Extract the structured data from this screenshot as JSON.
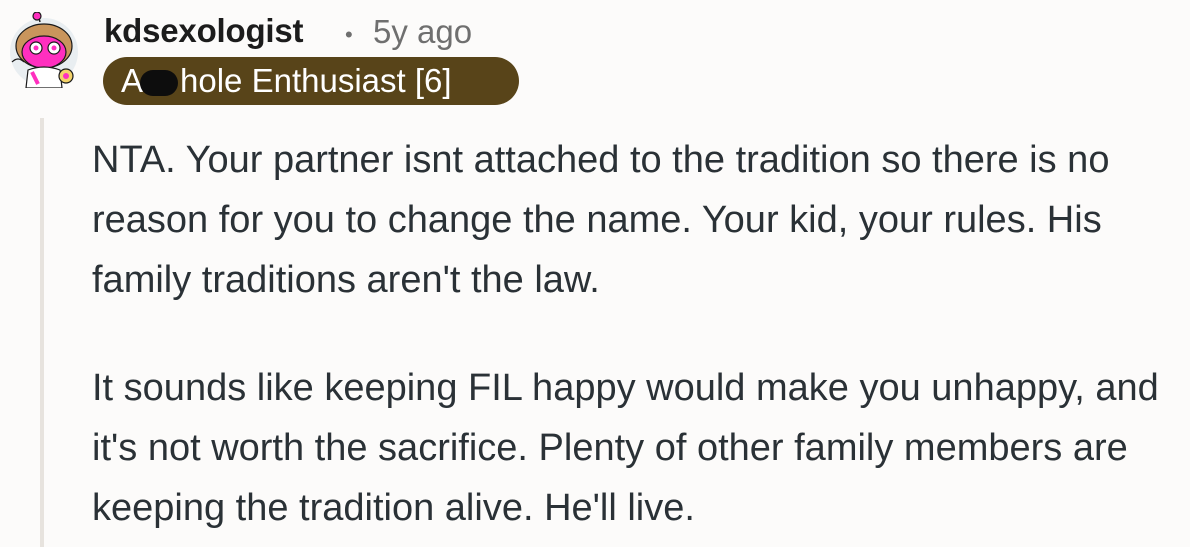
{
  "comment": {
    "author": "kdsexologist",
    "separator": "•",
    "timestamp": "5y ago",
    "flair": {
      "prefix": "A",
      "suffix": "hole Enthusiast [6]",
      "background_color": "#584419"
    },
    "avatar_icon": "snoo-avatar-icon",
    "paragraphs": [
      "NTA. Your partner isnt attached to the tradition so there is no reason for you to change the name. Your kid, your rules. His family traditions aren't the law.",
      "It sounds like keeping FIL happy would make you unhappy, and it's not worth the sacrifice. Plenty of other family members are keeping the tradition alive. He'll live."
    ]
  }
}
